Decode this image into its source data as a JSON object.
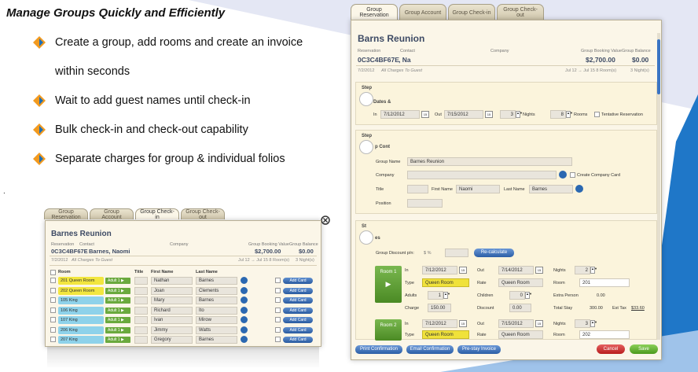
{
  "page": {
    "title": "Manage Groups Quickly and Efficiently",
    "bullets": [
      "Create a group, add rooms and create an invoice",
      "within seconds",
      "Wait to add guest names until check-in",
      "Bulk check-in and check-out capability",
      "Separate charges for group & individual folios"
    ],
    "dot": "."
  },
  "colors": {
    "accent_blue": "#2b68b1",
    "bullet_orange": "#f29a1f",
    "bg_triangle": "#dfe3f2",
    "bg_blue": "#1f77c8"
  },
  "small_window": {
    "tabs": [
      "Group Reservation",
      "Group Account",
      "Group Check-in",
      "Group Check-out"
    ],
    "active_tab": "Group Check-in",
    "group_name": "Barnes Reunion",
    "labels": {
      "reservation": "Reservation",
      "contact": "Contact",
      "company": "Company",
      "booking_value": "Group Booking Value",
      "balance": "Group Balance"
    },
    "reservation_id": "0C3C4BF67E",
    "contact": "Barnes, Naomi",
    "booking_value": "$2,700.00",
    "balance": "$0.00",
    "date": "7/2/2012",
    "charges": "All Charges To Guest",
    "stay": "Jul 12 → Jul 15  8 Room(s)",
    "nights": "3 Night(s)",
    "columns": [
      "Room",
      "Title",
      "First Name",
      "Last Name"
    ],
    "adult_label": "Adult 1",
    "add_card": "Add Card",
    "rows": [
      {
        "room": "201 Queen Room",
        "first": "Nathan",
        "last": "Barnes",
        "color": "yellow"
      },
      {
        "room": "202 Queen Room",
        "first": "Joan",
        "last": "Clements",
        "color": "yellow"
      },
      {
        "room": "105 King",
        "first": "Mary",
        "last": "Barnes",
        "color": "blue"
      },
      {
        "room": "106 King",
        "first": "Richard",
        "last": "Ito",
        "color": "blue"
      },
      {
        "room": "107 King",
        "first": "Ivan",
        "last": "Mirow",
        "color": "blue"
      },
      {
        "room": "206 King",
        "first": "Jimmy",
        "last": "Watts",
        "color": "blue"
      },
      {
        "room": "207 King",
        "first": "Gregory",
        "last": "Barnes",
        "color": "blue"
      }
    ]
  },
  "large_window": {
    "tabs": [
      "Group Reservation",
      "Group Account",
      "Group Check-in",
      "Group Check-out"
    ],
    "active_tab": "Group Reservation",
    "group_name": "Barns Reunion",
    "labels": {
      "reservation": "Reservation",
      "contact": "Contact",
      "company": "Company",
      "booking_value": "Group Booking Value",
      "balance": "Group Balance"
    },
    "reservation_id": "0C3C4BF67E",
    "contact": ", Na",
    "booking_value": "$2,700.00",
    "balance": "$0.00",
    "date": "7/2/2012",
    "charges": "All Charges To Guest",
    "stay": "Jul 12 → Jul 15  8 Room(s)",
    "nights": "3 Night(s)",
    "step_label": "Step",
    "dates": {
      "section": "Dates &",
      "in_label": "In",
      "in": "7/12/2012",
      "out_label": "Out",
      "out": "7/15/2012",
      "nights_val": "3",
      "nights_label": "Nights",
      "rooms_val": "8",
      "rooms_label": "Rooms",
      "tentative": "Tentative Reservation"
    },
    "contact_sec": {
      "section": "p Cont",
      "group_name_label": "Group Name",
      "group_name": "Barnes Reunion",
      "company_label": "Company",
      "create_company": "Create Company Card",
      "title_label": "Title",
      "first_label": "First Name",
      "first": "Naomi",
      "last_label": "Last Name",
      "last": "Barnes",
      "position_label": "Position"
    },
    "rooms_sec": {
      "step_label": "St",
      "section": "es",
      "discount_label": "Group Discount p/n:",
      "discount_opts": "$ %",
      "recalc": "Re-calculate",
      "room1": {
        "label": "Room 1",
        "in": "7/12/2012",
        "out": "7/14/2012",
        "nights": "2",
        "type": "Queen Room",
        "rate": "Queen Room",
        "room": "201",
        "adults": "1",
        "children": "0",
        "extra_person": "0.00",
        "charge": "150.00",
        "discount": "0.00",
        "total_stay": "300.00",
        "est_tax": "$33.60"
      },
      "room2": {
        "label": "Room 2",
        "in": "7/12/2012",
        "out": "7/15/2012",
        "nights": "3",
        "type": "Queen Room",
        "rate": "Queen Room",
        "room": "202"
      },
      "labels": {
        "in": "In",
        "out": "Out",
        "nights": "Nights",
        "type": "Type",
        "rate": "Rate",
        "room": "Room",
        "adults": "Adults",
        "children": "Children",
        "extra": "Extra Person",
        "charge": "Charge",
        "discount": "Discount",
        "total": "Total Stay",
        "tax": "Est Tax"
      }
    },
    "buttons": {
      "print": "Print Confirmation",
      "email": "Email Confirmation",
      "prestay": "Pre-stay Invoice",
      "cancel": "Cancel",
      "save": "Save"
    }
  }
}
